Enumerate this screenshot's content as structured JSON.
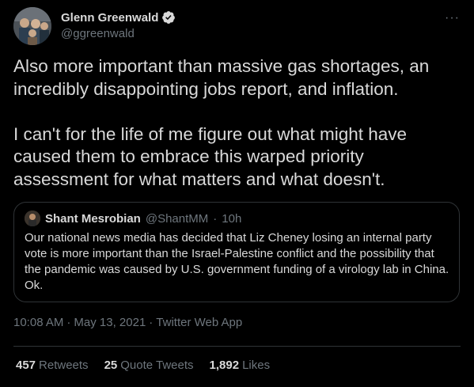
{
  "author": {
    "name": "Glenn Greenwald",
    "handle": "@ggreenwald"
  },
  "tweet_text": "Also more important than massive gas shortages, an incredibly disappointing jobs report, and inflation.\n\nI can't for the life of me figure out what might have caused them to embrace this warped priority assessment for what matters and what doesn't.",
  "quoted_tweet": {
    "name": "Shant Mesrobian",
    "handle": "@ShantMM",
    "dot": "·",
    "time": "10h",
    "text": "Our national news media has decided that Liz Cheney losing an internal party vote is more important than the Israel-Palestine conflict and the possibility that the pandemic was caused by U.S. government funding of a virology lab in China. Ok."
  },
  "meta": {
    "time": "10:08 AM",
    "sep1": "·",
    "date": "May 13, 2021",
    "sep2": "·",
    "source": "Twitter Web App"
  },
  "stats": {
    "retweets_count": "457",
    "retweets_label": "Retweets",
    "quotes_count": "25",
    "quotes_label": "Quote Tweets",
    "likes_count": "1,892",
    "likes_label": "Likes"
  },
  "more_icon": "···",
  "colors": {
    "background": "#000000",
    "text": "#d9d9d9",
    "muted": "#6e767d",
    "border": "#2f3336",
    "verified": "#1d9bf0"
  }
}
